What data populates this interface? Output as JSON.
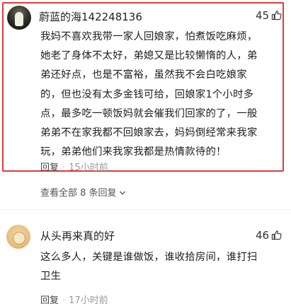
{
  "comments": [
    {
      "username": "蔚蓝的海142248136",
      "likes": "45",
      "lines": [
        "我妈不喜欢我带一家人回娘家，怕煮饭吃麻烦，",
        "她老了身体不太好，弟媳又是比较懒惰的人，弟",
        "弟还好点，也是不富裕，虽然我不会白吃娘家",
        "的，但也没有太多金钱可给，回娘家1个小时多",
        "点，最多吃一顿饭妈就会催我们回家的了，一般",
        "弟弟不在家我都不回娘家去，妈妈倒经常来我家",
        "玩，弟弟他们来我家我都是热情款待的！"
      ],
      "reply_label": "回复",
      "separator": "·",
      "time": "15小时前",
      "view_replies": "查看全部 8 条回复"
    },
    {
      "username": "从头再来真的好",
      "likes": "46",
      "lines": [
        "这么多人，关键是谁做饭，谁收拾房间，谁打扫",
        "卫生"
      ],
      "reply_label": "回复",
      "separator": "·",
      "time": "17小时前"
    }
  ],
  "icons": {
    "like": "thumbs-up-icon",
    "expand": "chevron-down-icon"
  },
  "colors": {
    "highlight_border": "#e23a3a"
  }
}
